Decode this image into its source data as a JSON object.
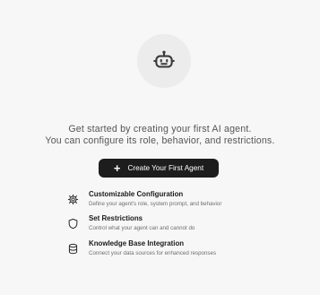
{
  "intro": {
    "line1": "Get started by creating your first AI agent.",
    "line2": "You can configure its role, behavior, and restrictions."
  },
  "create_button": {
    "label": "Create Your First Agent",
    "icon": "plus-icon"
  },
  "features": [
    {
      "icon": "gear-icon",
      "title": "Customizable Configuration",
      "description": "Define your agent's role, system prompt, and behavior"
    },
    {
      "icon": "shield-icon",
      "title": "Set Restrictions",
      "description": "Control what your agent can and cannot do"
    },
    {
      "icon": "database-icon",
      "title": "Knowledge Base Integration",
      "description": "Connect your data sources for enhanced responses"
    }
  ],
  "header_icon": "robot-icon",
  "colors": {
    "background": "#f7f7f7",
    "button_bg": "#1d1d1d",
    "button_text": "#ffffff",
    "text_muted": "#555555"
  }
}
